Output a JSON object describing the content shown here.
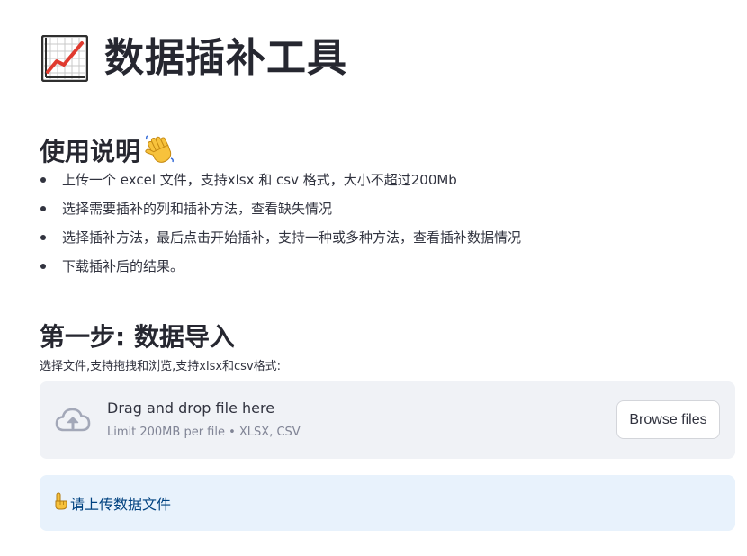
{
  "header": {
    "title_icon": "chart-increasing-icon",
    "title": "数据插补工具"
  },
  "usage": {
    "heading": "使用说明",
    "heading_icon": "waving-hand-icon",
    "items": [
      "上传一个 excel 文件，支持xlsx 和 csv 格式，大小不超过200Mb",
      "选择需要插补的列和插补方法，查看缺失情况",
      "选择插补方法，最后点击开始插补，支持一种或多种方法，查看插补数据情况",
      "下载插补后的结果。"
    ]
  },
  "step1": {
    "heading": "第一步: 数据导入",
    "uploader_label": "选择文件,支持拖拽和浏览,支持xlsx和csv格式:",
    "dropzone": {
      "icon": "cloud-upload-icon",
      "main_text": "Drag and drop file here",
      "sub_text": "Limit 200MB per file • XLSX, CSV",
      "browse_label": "Browse files"
    },
    "info": {
      "icon": "pointing-up-icon",
      "text": "请上传数据文件"
    }
  },
  "colors": {
    "info_bg": "#e8f2fc",
    "info_text": "#004280",
    "dropzone_bg": "#f0f2f6",
    "text": "#31333f"
  }
}
